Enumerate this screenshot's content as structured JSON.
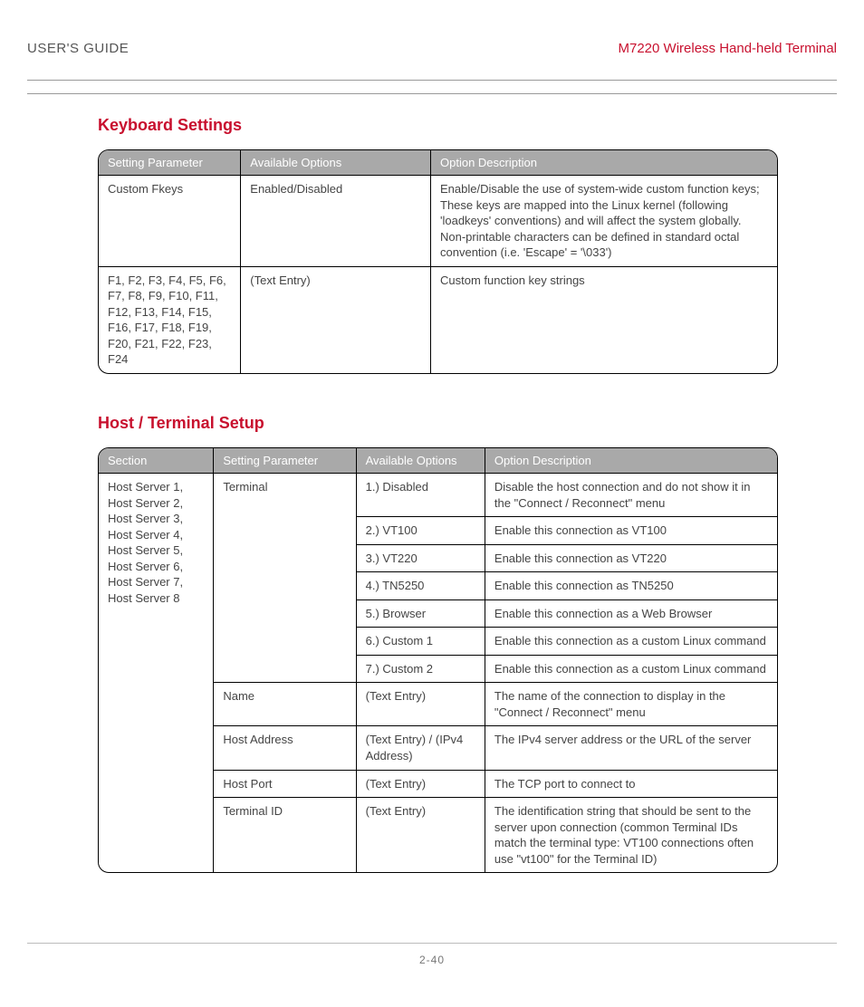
{
  "header": {
    "left": "USER'S GUIDE",
    "right": "M7220 Wireless Hand-held Terminal"
  },
  "section1": {
    "title": "Keyboard Settings",
    "columns": [
      "Setting Parameter",
      "Available Options",
      "Option Description"
    ],
    "rows": [
      {
        "param": "Custom Fkeys",
        "options": "Enabled/Disabled",
        "desc": "Enable/Disable the use of system-wide custom function keys; These keys are mapped into the Linux kernel (following 'loadkeys' conventions) and will affect the system globally. Non-printable characters can be defined in standard octal convention (i.e. 'Escape' = '\\033')"
      },
      {
        "param": "F1, F2, F3, F4, F5, F6, F7, F8, F9, F10, F11, F12, F13, F14, F15, F16, F17, F18, F19, F20, F21, F22, F23, F24",
        "options": "(Text Entry)",
        "desc": "Custom function key strings"
      }
    ]
  },
  "section2": {
    "title": "Host / Terminal Setup",
    "columns": [
      "Section",
      "Setting Parameter",
      "Available Options",
      "Option Description"
    ],
    "sectionCell": "Host Server 1, Host Server 2, Host Server 3, Host Server 4, Host Server 5, Host Server 6, Host Server 7, Host Server 8",
    "terminal": {
      "param": "Terminal",
      "options": [
        {
          "opt": "1.) Disabled",
          "desc": "Disable the host connection and do not show it in the \"Connect / Reconnect\" menu"
        },
        {
          "opt": "2.) VT100",
          "desc": "Enable this connection as VT100"
        },
        {
          "opt": "3.) VT220",
          "desc": "Enable this connection as VT220"
        },
        {
          "opt": "4.) TN5250",
          "desc": "Enable this connection as TN5250"
        },
        {
          "opt": "5.) Browser",
          "desc": "Enable this connection as a Web Browser"
        },
        {
          "opt": "6.) Custom 1",
          "desc": "Enable this connection as a custom Linux command"
        },
        {
          "opt": "7.) Custom 2",
          "desc": "Enable this connection as a custom Linux command"
        }
      ]
    },
    "rows": [
      {
        "param": "Name",
        "opt": "(Text Entry)",
        "desc": "The name of the connection to display in the \"Connect / Reconnect\" menu"
      },
      {
        "param": "Host Address",
        "opt": "(Text Entry) / (IPv4 Address)",
        "desc": "The IPv4 server address or the URL of the server"
      },
      {
        "param": "Host Port",
        "opt": "(Text Entry)",
        "desc": "The TCP port to connect to"
      },
      {
        "param": "Terminal ID",
        "opt": "(Text Entry)",
        "desc": "The identification string that should be sent to the server upon connection (common Terminal IDs match the terminal type: VT100 connections often use \"vt100\" for the Terminal ID)"
      }
    ]
  },
  "footer": {
    "page": "2-40"
  }
}
